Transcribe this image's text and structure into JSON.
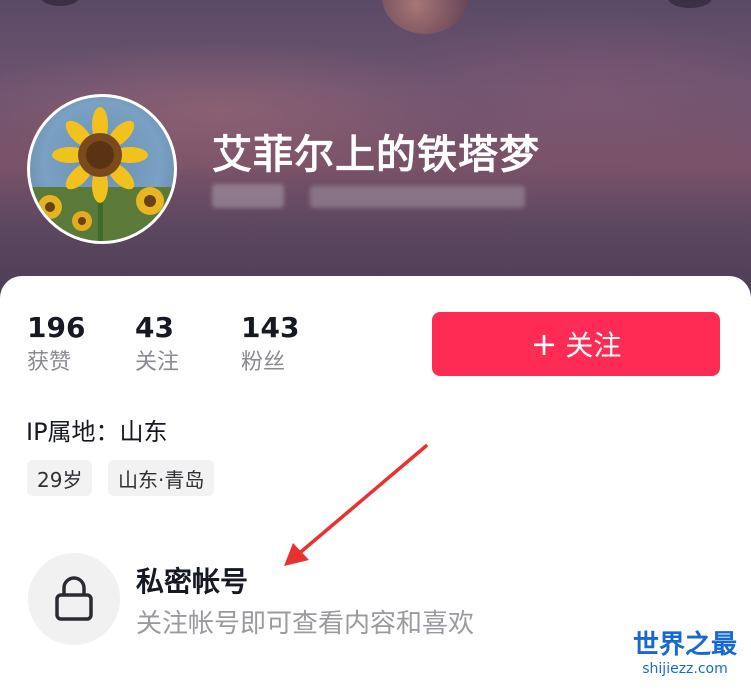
{
  "profile": {
    "username": "艾菲尔上的铁塔梦"
  },
  "stats": [
    {
      "value": "196",
      "label": "获赞"
    },
    {
      "value": "43",
      "label": "关注"
    },
    {
      "value": "143",
      "label": "粉丝"
    }
  ],
  "follow_button": {
    "icon": "plus-icon",
    "label": "关注",
    "color": "#fe2c55"
  },
  "ip_location": "IP属地：山东",
  "tags": [
    "29岁",
    "山东·青岛"
  ],
  "private_notice": {
    "icon": "lock-icon",
    "title": "私密帐号",
    "subtitle": "关注帐号即可查看内容和喜欢"
  },
  "annotation": {
    "type": "red-arrow",
    "color": "#e8322f"
  },
  "watermark": {
    "title": "世界之最",
    "site": "shijiezz.com"
  }
}
